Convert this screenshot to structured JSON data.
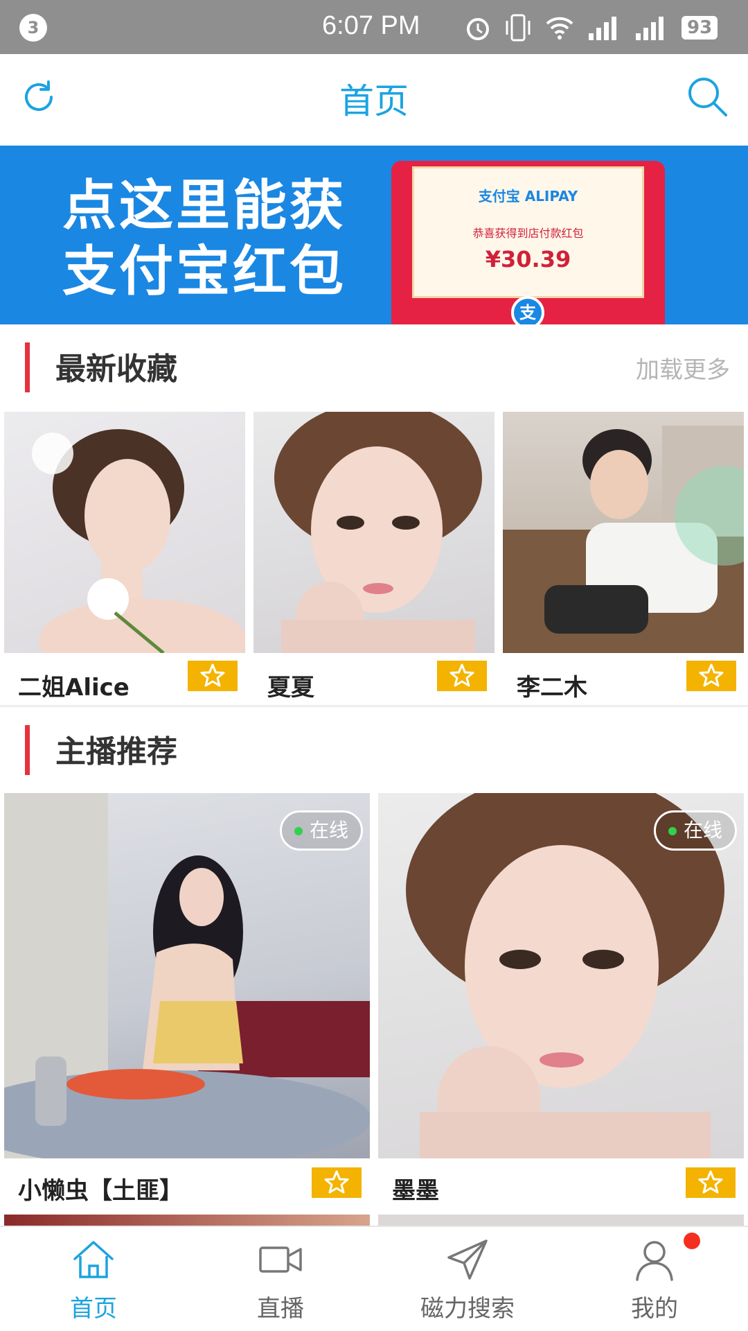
{
  "status_bar": {
    "notification_count": "3",
    "time": "6:07 PM",
    "battery": "93",
    "icons": [
      "alarm-icon",
      "vibrate-icon",
      "wifi-icon",
      "signal-icon",
      "signal-2-icon"
    ]
  },
  "header": {
    "title": "首页",
    "left_icon": "refresh-icon",
    "right_icon": "search-icon",
    "accent_color": "#1ba3e0"
  },
  "banner": {
    "line1": "点这里能获",
    "line2": "支付宝红包",
    "envelope_logo": "支付宝 ALIPAY",
    "envelope_message": "恭喜获得到店付款红包",
    "envelope_amount": "¥30.39",
    "envelope_seal": "支",
    "background_color": "#1a87e3"
  },
  "favorites": {
    "title": "最新收藏",
    "more_label": "加载更多",
    "items": [
      {
        "name": "二姐Alice"
      },
      {
        "name": "夏夏"
      },
      {
        "name": "李二木"
      }
    ]
  },
  "recommended": {
    "title": "主播推荐",
    "items": [
      {
        "name": "小懒虫【土匪】",
        "status": "在线"
      },
      {
        "name": "墨墨",
        "status": "在线"
      }
    ]
  },
  "bottom_nav": {
    "items": [
      {
        "label": "首页",
        "icon": "home-icon",
        "active": true
      },
      {
        "label": "直播",
        "icon": "video-camera-icon",
        "active": false
      },
      {
        "label": "磁力搜索",
        "icon": "paper-plane-icon",
        "active": false
      },
      {
        "label": "我的",
        "icon": "user-icon",
        "active": false,
        "badge": true
      }
    ],
    "active_color": "#1ba3e0",
    "badge_color": "#f52f1f"
  }
}
